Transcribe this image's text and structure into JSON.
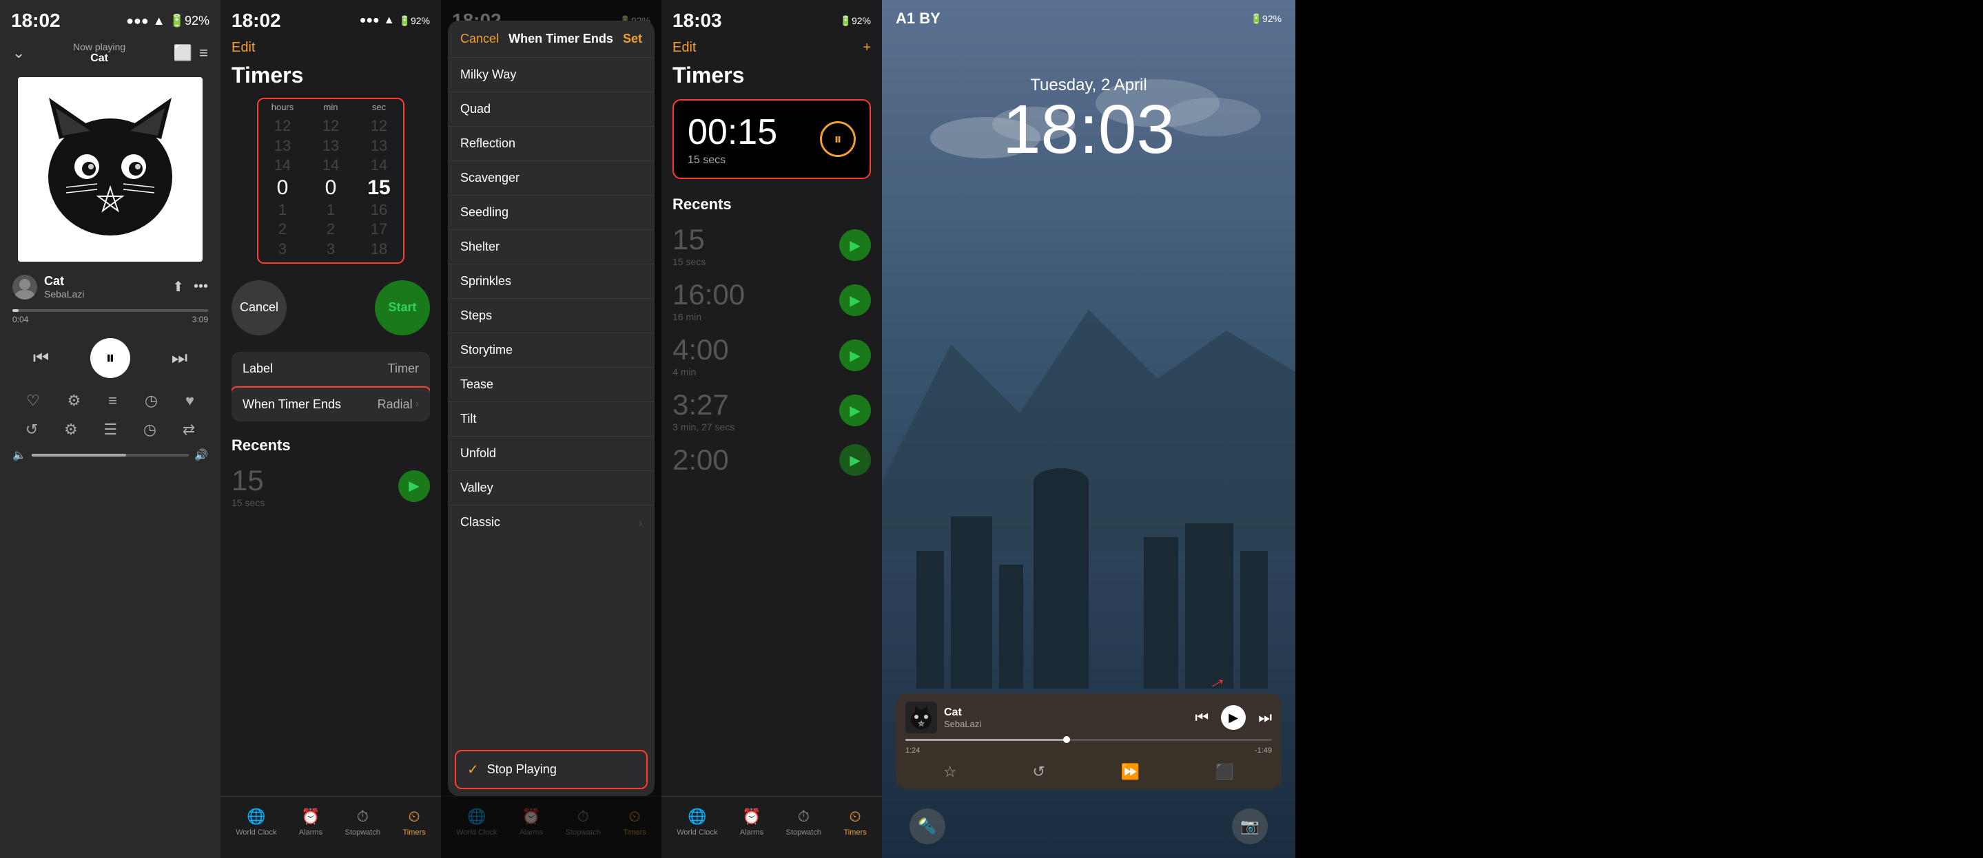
{
  "panel1": {
    "statusTime": "18:02",
    "nowPlayingLabel": "Now playing",
    "trackName": "Cat",
    "artistName": "SebaLazi",
    "progressCurrent": "0:04",
    "progressTotal": "3:09",
    "controls": {
      "back": "⏮",
      "pause": "⏸",
      "forward": "⏭"
    }
  },
  "panel2": {
    "statusTime": "18:02",
    "editLabel": "Edit",
    "title": "Timers",
    "picker": {
      "hoursLabel": "hours",
      "minLabel": "min",
      "secLabel": "sec",
      "hoursVal": "0",
      "minVal": "0",
      "secVal": "15",
      "rows": [
        "12",
        "13",
        "14",
        "1",
        "2",
        "3",
        "15",
        "16",
        "17",
        "18"
      ]
    },
    "cancelLabel": "Cancel",
    "startLabel": "Start",
    "settings": {
      "labelKey": "Label",
      "labelVal": "Timer",
      "whenKey": "When Timer Ends",
      "whenVal": "Radial"
    },
    "recentsTitle": "Recents",
    "recentItem": {
      "time": "15",
      "sub": "15 secs"
    },
    "tabs": [
      {
        "icon": "🌐",
        "label": "World Clock"
      },
      {
        "icon": "⏰",
        "label": "Alarms"
      },
      {
        "icon": "⏱",
        "label": "Stopwatch"
      },
      {
        "icon": "⏲",
        "label": "Timers"
      }
    ]
  },
  "panel3": {
    "statusTime": "18:02",
    "cancelLabel": "Cancel",
    "title": "When Timer Ends",
    "setLabel": "Set",
    "listItems": [
      {
        "name": "Milky Way",
        "chevron": false,
        "checked": false
      },
      {
        "name": "Quad",
        "chevron": false,
        "checked": false
      },
      {
        "name": "Reflection",
        "chevron": false,
        "checked": false
      },
      {
        "name": "Scavenger",
        "chevron": false,
        "checked": false
      },
      {
        "name": "Seedling",
        "chevron": false,
        "checked": false
      },
      {
        "name": "Shelter",
        "chevron": false,
        "checked": false
      },
      {
        "name": "Sprinkles",
        "chevron": false,
        "checked": false
      },
      {
        "name": "Steps",
        "chevron": false,
        "checked": false
      },
      {
        "name": "Storytime",
        "chevron": false,
        "checked": false
      },
      {
        "name": "Tease",
        "chevron": false,
        "checked": false
      },
      {
        "name": "Tilt",
        "chevron": false,
        "checked": false
      },
      {
        "name": "Unfold",
        "chevron": false,
        "checked": false
      },
      {
        "name": "Valley",
        "chevron": false,
        "checked": false
      },
      {
        "name": "Classic",
        "chevron": true,
        "checked": false
      }
    ],
    "stopPlayingLabel": "Stop Playing",
    "tabs": [
      {
        "icon": "🌐",
        "label": "World Clock"
      },
      {
        "icon": "⏰",
        "label": "Alarms"
      },
      {
        "icon": "⏱",
        "label": "Stopwatch"
      },
      {
        "icon": "⏲",
        "label": "Timers"
      }
    ]
  },
  "panel4": {
    "statusTime": "18:03",
    "editLabel": "Edit",
    "addLabel": "+",
    "title": "Timers",
    "runningTime": "00:15",
    "runningSub": "15 secs",
    "recentsTitle": "Recents",
    "recentItems": [
      {
        "time": "15",
        "sub": "15 secs"
      },
      {
        "time": "16:00",
        "sub": "16 min"
      },
      {
        "time": "4:00",
        "sub": "4 min"
      },
      {
        "time": "3:27",
        "sub": "3 min, 27 secs"
      },
      {
        "time": "2:00",
        "sub": ""
      }
    ],
    "tabs": [
      {
        "icon": "🌐",
        "label": "World Clock"
      },
      {
        "icon": "⏰",
        "label": "Alarms"
      },
      {
        "icon": "⏱",
        "label": "Stopwatch"
      },
      {
        "icon": "⏲",
        "label": "Timers"
      }
    ]
  },
  "panel5": {
    "statusTime": "A1 BY",
    "date": "Tuesday, 2 April",
    "time": "18:03",
    "miniPlayer": {
      "title": "Cat",
      "artist": "SebaLazi",
      "timeLeft": "1:24",
      "timeRight": "-1:49"
    }
  }
}
